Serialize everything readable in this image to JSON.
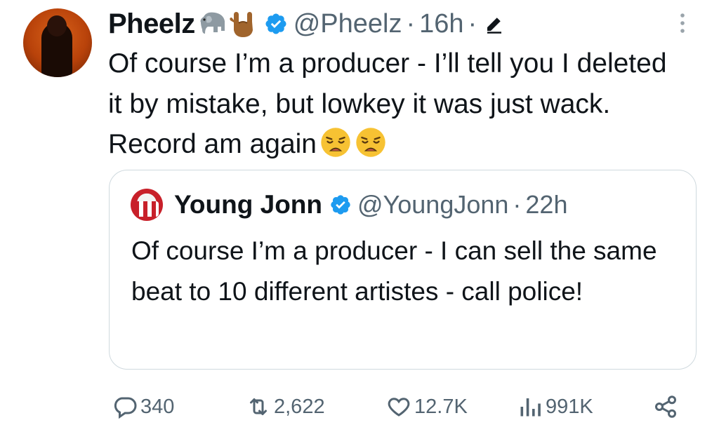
{
  "tweet": {
    "author_name": "Pheelz",
    "author_handle": "@Pheelz",
    "separator": "·",
    "time": "16h",
    "name_emojis": [
      "elephant-emoji",
      "love-you-gesture-emoji"
    ],
    "text": "Of course I’m a producer - I’ll tell you I deleted it by mistake, but lowkey it was just wack. Record am again",
    "text_emojis": [
      "weary-face-emoji",
      "weary-face-emoji"
    ]
  },
  "quoted_tweet": {
    "author_name": "Young Jonn",
    "author_handle": "@YoungJonn",
    "separator": "·",
    "time": "22h",
    "text": "Of course I’m a producer - I can sell the same beat to 10 different artistes - call police!"
  },
  "actions": {
    "replies": "340",
    "reposts": "2,622",
    "likes": "12.7K",
    "views": "991K"
  },
  "icons": {
    "verified": "verified-badge-icon",
    "edit": "edited-pencil-icon",
    "more": "more-options-icon",
    "reply": "reply-icon",
    "repost": "repost-icon",
    "like": "like-heart-icon",
    "views": "views-chart-icon",
    "share": "share-icon"
  },
  "colors": {
    "text": "#0f1419",
    "secondary": "#536471",
    "verified_blue": "#1d9bf0",
    "border": "#cfd9de"
  }
}
